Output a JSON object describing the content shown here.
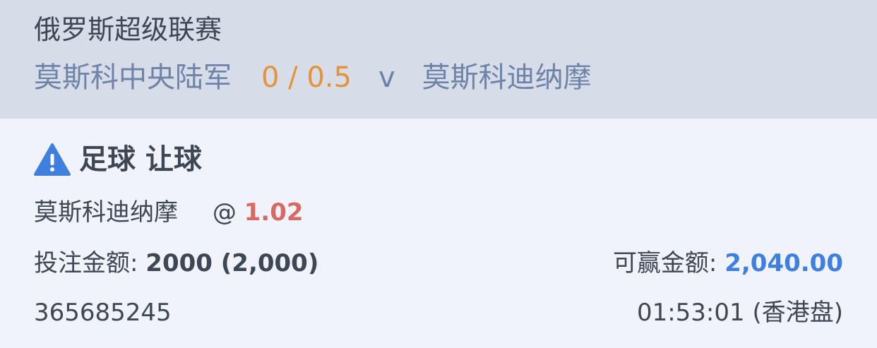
{
  "header": {
    "league": "俄罗斯超级联赛",
    "home_team": "莫斯科中央陆军",
    "handicap": "0 / 0.5",
    "vs": "v",
    "away_team": "莫斯科迪纳摩"
  },
  "bet": {
    "type_label": "足球 让球",
    "icon": "warning-triangle-icon",
    "selection": "莫斯科迪纳摩",
    "at": "@",
    "odds": "1.02",
    "stake_label": "投注金额:",
    "stake_value": "2000 (2,000)",
    "win_label": "可赢金额:",
    "win_value": "2,040.00",
    "ticket_id": "365685245",
    "time": "01:53:01 (香港盘)"
  },
  "colors": {
    "header_bg": "#d6dce8",
    "body_bg": "#f0f3fa",
    "team": "#6f83a8",
    "handicap": "#e69236",
    "odds": "#d86a66",
    "win": "#3f7fe0",
    "icon": "#3f7fe0"
  }
}
